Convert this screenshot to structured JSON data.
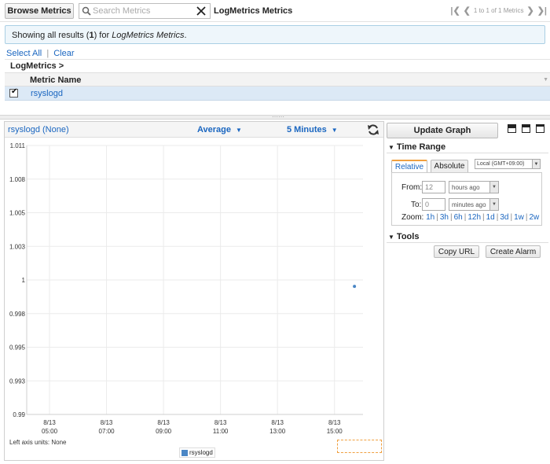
{
  "topbar": {
    "browse_label": "Browse Metrics",
    "search_placeholder": "Search Metrics",
    "title": "LogMetrics Metrics",
    "pager_text": "1 to 1 of 1 Metrics"
  },
  "banner": {
    "prefix": "Showing all results (",
    "count": "1",
    "middle": ") for ",
    "namespace": "LogMetrics Metrics",
    "suffix": "."
  },
  "selection": {
    "select_all": "Select All",
    "separator": "|",
    "clear": "Clear"
  },
  "group": {
    "label": "LogMetrics >"
  },
  "table": {
    "column": "Metric Name",
    "rows": [
      {
        "name": "rsyslogd",
        "checked": true
      }
    ]
  },
  "graph": {
    "title": "rsyslogd (None)",
    "statistic": "Average",
    "period": "5 Minutes",
    "axis_units": "Left axis units:  None"
  },
  "chart_data": {
    "type": "line",
    "y_ticks": [
      "1.011",
      "1.008",
      "1.005",
      "1.003",
      "1",
      "0.998",
      "0.995",
      "0.993",
      "0.99"
    ],
    "ylim": [
      0.99,
      1.011
    ],
    "x_ticks": [
      {
        "date": "8/13",
        "time": "05:00"
      },
      {
        "date": "8/13",
        "time": "07:00"
      },
      {
        "date": "8/13",
        "time": "09:00"
      },
      {
        "date": "8/13",
        "time": "11:00"
      },
      {
        "date": "8/13",
        "time": "13:00"
      },
      {
        "date": "8/13",
        "time": "15:00"
      }
    ],
    "xlim_hours": [
      4.2,
      16.0
    ],
    "grid": true,
    "series": [
      {
        "name": "rsyslogd",
        "color": "#4a86c5",
        "points": [
          {
            "hour": 15.7,
            "value": 1
          }
        ]
      }
    ],
    "legend": "bottom-center"
  },
  "side": {
    "update_label": "Update Graph",
    "time_range_label": "Time Range",
    "tab_relative": "Relative",
    "tab_absolute": "Absolute",
    "timezone": "Local (GMT+09:00)",
    "from_label": "From:",
    "from_value": "12",
    "from_unit": "hours ago",
    "to_label": "To:",
    "to_value": "0",
    "to_unit": "minutes ago",
    "zoom_label": "Zoom:",
    "zoom_options": [
      "1h",
      "3h",
      "6h",
      "12h",
      "1d",
      "3d",
      "1w",
      "2w"
    ],
    "tools_label": "Tools",
    "copy_url_label": "Copy URL",
    "create_alarm_label": "Create Alarm"
  },
  "colors": {
    "link": "#1a66c0",
    "series": "#4a86c5",
    "banner_bg": "#eef6fb",
    "selected_row": "#dce9f6"
  }
}
